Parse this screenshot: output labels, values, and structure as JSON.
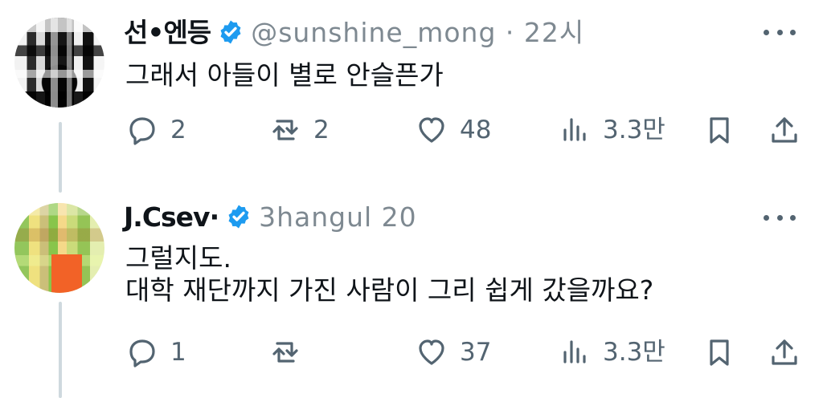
{
  "tweets": [
    {
      "display_name": "선•엔등",
      "handle_time": "@sunshine_mong · 22시",
      "text": "그래서 아들이 별로 안슬픈가",
      "replies": "2",
      "reposts": "2",
      "likes": "48",
      "views": "3.3만"
    },
    {
      "display_name": "J.Csev·",
      "handle_time": "3hangul 20",
      "text": "그럴지도.\n대학 재단까지 가진 사람이 그리 쉽게 갔을까요?",
      "replies": "1",
      "reposts": "",
      "likes": "37",
      "views": "3.3만"
    }
  ],
  "icons": {
    "reply": "reply-icon",
    "repost": "repost-icon",
    "like": "heart-icon",
    "views": "analytics-icon",
    "bookmark": "bookmark-icon",
    "share": "share-icon",
    "verified": "verified-badge-icon",
    "more": "more-icon"
  },
  "colors": {
    "text": "#0f1419",
    "muted": "#536471",
    "verified": "#1d9bf0",
    "thread_line": "#cfd9de"
  }
}
